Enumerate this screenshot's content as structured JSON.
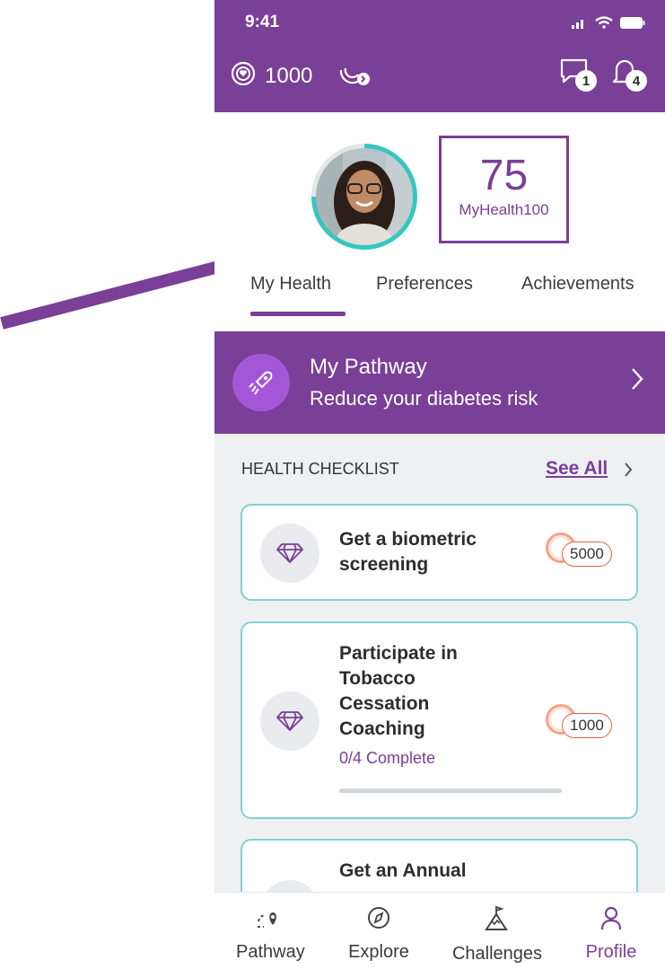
{
  "status": {
    "time": "9:41"
  },
  "header": {
    "coins": "1000",
    "messages_badge": "1",
    "notifications_badge": "4"
  },
  "profile": {
    "score": "75",
    "score_label": "MyHealth100",
    "ring_fraction": 0.75
  },
  "tabs": [
    {
      "label": "My Health",
      "active": true
    },
    {
      "label": "Preferences",
      "active": false
    },
    {
      "label": "Achievements",
      "active": false
    }
  ],
  "pathway": {
    "title": "My Pathway",
    "subtitle": "Reduce your diabetes risk"
  },
  "checklist": {
    "heading": "HEALTH CHECKLIST",
    "see_all": "See All",
    "items": [
      {
        "title": "Get a biometric screening",
        "reward": "5000"
      },
      {
        "title": "Participate in Tobacco Cessation Coaching",
        "reward": "1000",
        "progress_text": "0/4 Complete",
        "progress": 0
      },
      {
        "title": "Get an Annual"
      }
    ]
  },
  "nav": [
    {
      "label": "Pathway",
      "icon": "pathway-icon"
    },
    {
      "label": "Explore",
      "icon": "compass-icon"
    },
    {
      "label": "Challenges",
      "icon": "mountain-icon"
    },
    {
      "label": "Profile",
      "icon": "person-icon",
      "active": true
    }
  ],
  "colors": {
    "brand": "#7a3f96",
    "accent": "#35c6c0"
  }
}
